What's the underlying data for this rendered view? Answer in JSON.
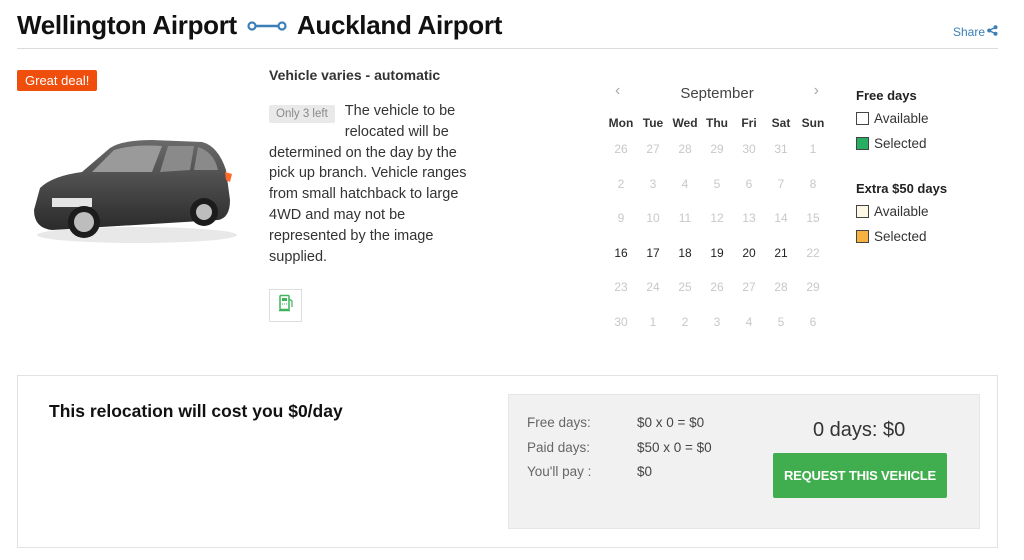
{
  "header": {
    "origin": "Wellington Airport",
    "destination": "Auckland Airport",
    "route_icon": "route-connector-icon",
    "share_label": "Share",
    "share_icon": "share-icon",
    "accent_color": "#3c7fb8"
  },
  "vehicle": {
    "deal_badge": "Great deal!",
    "deal_color": "#f04e0c",
    "image": "car-image",
    "title": "Vehicle varies - automatic",
    "stock_badge": "Only 3 left",
    "description": "The vehicle to be relocated will be determined on the day by the pick up branch. Vehicle ranges from small hatchback to large 4WD and may not be represented by the image supplied.",
    "feature_icon": "fuel-pump-icon"
  },
  "calendar": {
    "month": "September",
    "prev_icon": "chevron-left-icon",
    "next_icon": "chevron-right-icon",
    "weekdays": [
      "Mon",
      "Tue",
      "Wed",
      "Thu",
      "Fri",
      "Sat",
      "Sun"
    ],
    "weeks": [
      [
        {
          "d": "26",
          "a": false
        },
        {
          "d": "27",
          "a": false
        },
        {
          "d": "28",
          "a": false
        },
        {
          "d": "29",
          "a": false
        },
        {
          "d": "30",
          "a": false
        },
        {
          "d": "31",
          "a": false
        },
        {
          "d": "1",
          "a": false
        }
      ],
      [
        {
          "d": "2",
          "a": false
        },
        {
          "d": "3",
          "a": false
        },
        {
          "d": "4",
          "a": false
        },
        {
          "d": "5",
          "a": false
        },
        {
          "d": "6",
          "a": false
        },
        {
          "d": "7",
          "a": false
        },
        {
          "d": "8",
          "a": false
        }
      ],
      [
        {
          "d": "9",
          "a": false
        },
        {
          "d": "10",
          "a": false
        },
        {
          "d": "11",
          "a": false
        },
        {
          "d": "12",
          "a": false
        },
        {
          "d": "13",
          "a": false
        },
        {
          "d": "14",
          "a": false
        },
        {
          "d": "15",
          "a": false
        }
      ],
      [
        {
          "d": "16",
          "a": true
        },
        {
          "d": "17",
          "a": true
        },
        {
          "d": "18",
          "a": true
        },
        {
          "d": "19",
          "a": true
        },
        {
          "d": "20",
          "a": true
        },
        {
          "d": "21",
          "a": true
        },
        {
          "d": "22",
          "a": false
        }
      ],
      [
        {
          "d": "23",
          "a": false
        },
        {
          "d": "24",
          "a": false
        },
        {
          "d": "25",
          "a": false
        },
        {
          "d": "26",
          "a": false
        },
        {
          "d": "27",
          "a": false
        },
        {
          "d": "28",
          "a": false
        },
        {
          "d": "29",
          "a": false
        }
      ],
      [
        {
          "d": "30",
          "a": false
        },
        {
          "d": "1",
          "a": false
        },
        {
          "d": "2",
          "a": false
        },
        {
          "d": "3",
          "a": false
        },
        {
          "d": "4",
          "a": false
        },
        {
          "d": "5",
          "a": false
        },
        {
          "d": "6",
          "a": false
        }
      ]
    ]
  },
  "legend": {
    "free": {
      "title": "Free days",
      "available": "Available",
      "selected": "Selected",
      "available_color": "#ffffff",
      "selected_color": "#27ae60"
    },
    "extra": {
      "title": "Extra $50 days",
      "available": "Available",
      "selected": "Selected",
      "available_color": "#fdf8e6",
      "selected_color": "#f7b13e"
    }
  },
  "cost": {
    "title": "This relocation will cost you $0/day",
    "rows": [
      {
        "label": "Free days:",
        "value": "$0 x 0 = $0"
      },
      {
        "label": "Paid days:",
        "value": "$50 x 0 = $0"
      },
      {
        "label": "You'll pay :",
        "value": "$0"
      }
    ],
    "total": "0 days: $0",
    "button_label": "REQUEST THIS VEHICLE",
    "button_color": "#40ae4e"
  }
}
